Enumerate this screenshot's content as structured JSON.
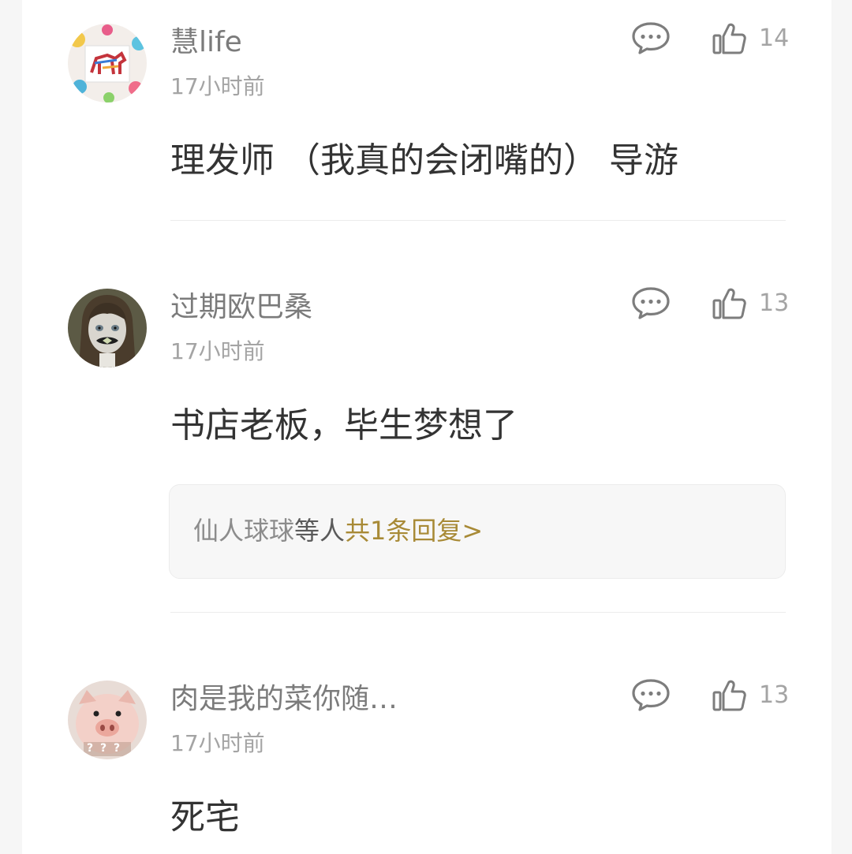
{
  "comments": [
    {
      "username": "慧life",
      "time": "17小时前",
      "likes": "14",
      "content": "理发师 （我真的会闭嘴的） 导游",
      "avatar_icon": "colorful-horse-painting-avatar"
    },
    {
      "username": "过期欧巴桑",
      "time": "17小时前",
      "likes": "13",
      "content": "书店老板，毕生梦想了",
      "avatar_icon": "doll-girl-avatar",
      "reply_summary": {
        "names": "仙人球球",
        "middle": "等人",
        "link": "共1条回复>"
      }
    },
    {
      "username": "肉是我的菜你随…",
      "time": "17小时前",
      "likes": "13",
      "content": "死宅",
      "avatar_icon": "piglet-avatar",
      "avatar_text": "? ? ?"
    }
  ],
  "colors": {
    "accent": "#a88a36",
    "username": "#7b7b7b",
    "meta": "#a4a4a4",
    "content": "#333333"
  }
}
